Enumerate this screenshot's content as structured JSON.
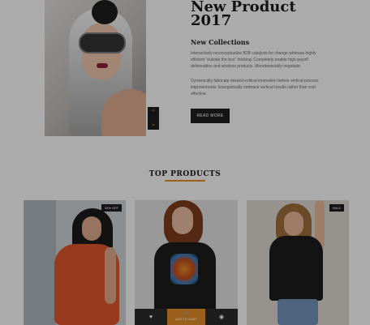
{
  "hero": {
    "title_line1": "New Product",
    "title_line2": "2017",
    "subtitle": "New Collections",
    "paragraph1": "Interactively reconceptualize B2B catalysts for change whereas highly efficient \"outside the box\" thinking. Completely enable high-payoff deliverables and wireless products. Monotonectally negotiate.",
    "paragraph2": "Dynamically fabricate mission-critical innovation before vertical process improvements. Energistically embrace vertical results rather than cost effective.",
    "button_label": "READ MORE",
    "arrow_up_glyph": "⌃",
    "arrow_down_glyph": "⌄"
  },
  "section": {
    "title": "TOP PRODUCTS"
  },
  "products": [
    {
      "badge": "33% OFF"
    },
    {
      "add_to_cart": "ADD TO CART",
      "wishlist_icon": "heart-icon",
      "cart_icon": "cart-icon",
      "view_icon": "eye-icon"
    },
    {
      "badge": "SALE"
    }
  ],
  "colors": {
    "accent": "#e08a2a",
    "dark": "#1e1e1e",
    "background": "#f5f5f5"
  }
}
